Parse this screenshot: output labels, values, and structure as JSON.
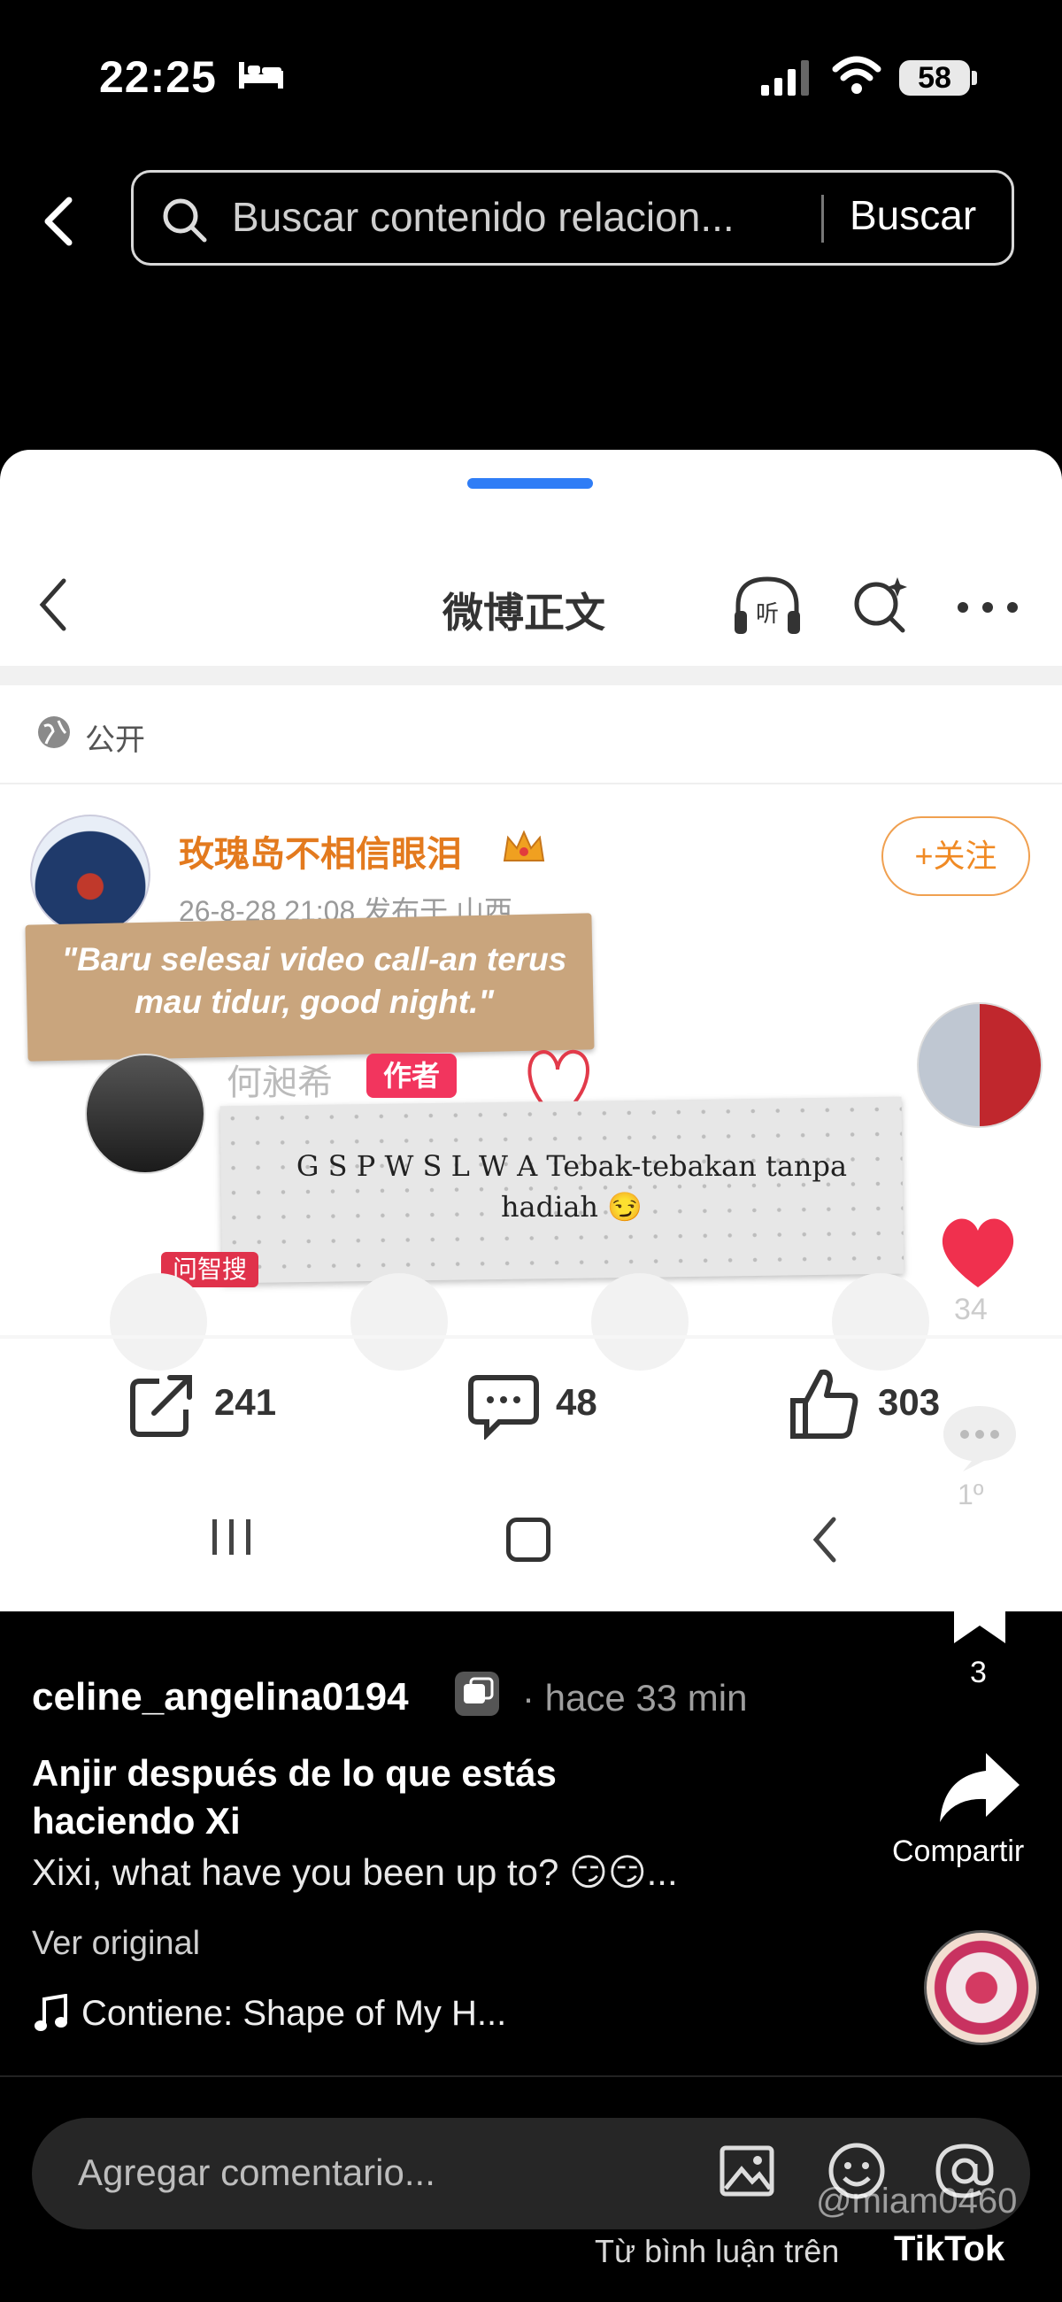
{
  "status_bar": {
    "time": "22:25",
    "battery": "58"
  },
  "search": {
    "placeholder": "Buscar contenido relacion...",
    "button": "Buscar"
  },
  "weibo": {
    "title": "微博正文",
    "visibility": "公开",
    "author": "玫瑰岛不相信眼泪",
    "meta": "26-8-28 21:08  发布于 山西",
    "follow": "+关注",
    "sticker_text": "\"Baru selesai video call-an terus mau tidur, good night.\"",
    "commenter": "何昶希",
    "author_badge": "作者",
    "paper_text": "G S P W S L W A    Tebak-tebakan tanpa hadiah 😏",
    "red_tag": "问智搜",
    "share_count": "241",
    "comment_count": "48",
    "like_count": "303",
    "side_like_count": "34",
    "side_comment_count": "1º"
  },
  "rail": {
    "bookmark_count": "3",
    "share_label": "Compartir"
  },
  "post": {
    "username": "celine_angelina0194",
    "time_ago": "· hace 33 min",
    "title": "Anjir después de lo que estás haciendo Xi",
    "translation": "Xixi, what have you been up to? 😏😏...",
    "see_original": "Ver original",
    "music": "Contiene: Shape of My H..."
  },
  "comment_bar": {
    "placeholder": "Agregar comentario...",
    "watermark_user": "@miam0460",
    "watermark_from": "Từ bình luận trên",
    "watermark_brand": "TikTok"
  },
  "colors": {
    "accent_blue": "#2f7df6",
    "follow_orange": "#f08a24",
    "like_red": "#f0304e",
    "author_badge": "#f2355e"
  }
}
